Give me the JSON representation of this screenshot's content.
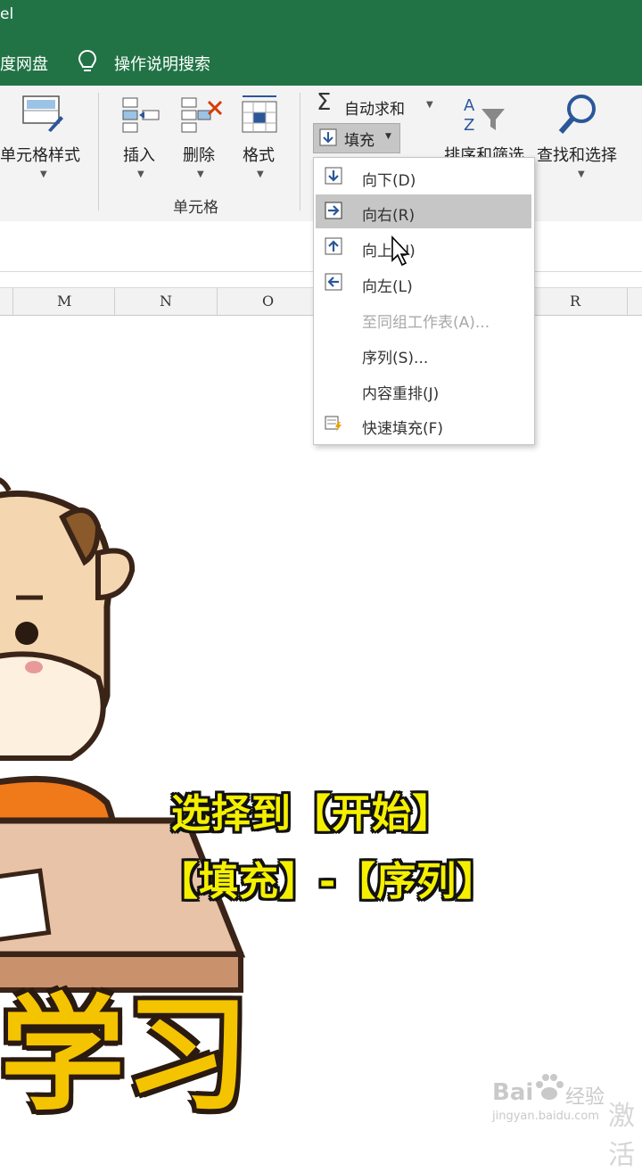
{
  "titlebar": {
    "title": "el"
  },
  "tabs": {
    "cloud": "度网盘",
    "search": "操作说明搜索"
  },
  "ribbon": {
    "cell_style": "单元格样式",
    "insert": "插入",
    "delete": "删除",
    "format": "格式",
    "cells_group": "单元格",
    "autosum": "自动求和",
    "fill": "填充",
    "sort_filter": "排序和筛选",
    "find_select": "查找和选择"
  },
  "columns": [
    "M",
    "N",
    "O",
    "R"
  ],
  "fill_menu": {
    "items": [
      {
        "label": "向下(D)",
        "icon": "arrow-down-icon",
        "state": "normal"
      },
      {
        "label": "向右(R)",
        "icon": "arrow-right-icon",
        "state": "highlighted"
      },
      {
        "label": "向上(U)",
        "icon": "arrow-up-icon",
        "state": "normal"
      },
      {
        "label": "向左(L)",
        "icon": "arrow-left-icon",
        "state": "normal"
      },
      {
        "label": "至同组工作表(A)...",
        "icon": "",
        "state": "disabled"
      },
      {
        "label": "序列(S)...",
        "icon": "",
        "state": "normal"
      },
      {
        "label": "内容重排(J)",
        "icon": "",
        "state": "normal"
      },
      {
        "label": "快速填充(F)",
        "icon": "flash-fill-icon",
        "state": "normal"
      }
    ]
  },
  "caption": {
    "line1": "选择到【开始】",
    "line2": "【填充】-【序列】"
  },
  "overlay": {
    "big_text": "学习"
  },
  "watermark": {
    "brand": "Bai",
    "brand2": "经验",
    "url": "jingyan.baidu.com",
    "side": "激活"
  },
  "colors": {
    "excel_green": "#217346",
    "caption_yellow": "#f5f000",
    "accent_blue": "#2b579a"
  }
}
